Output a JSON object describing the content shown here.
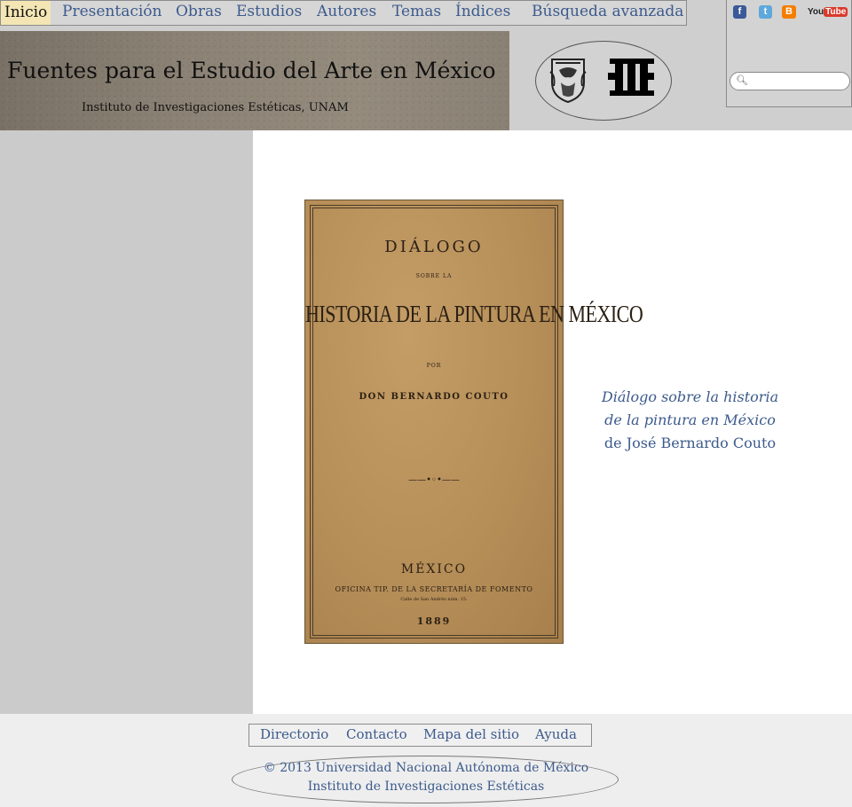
{
  "nav": {
    "items": [
      "Inicio",
      "Presentación",
      "Obras",
      "Estudios",
      "Autores",
      "Temas",
      "Índices",
      "Búsqueda avanzada"
    ],
    "active": "Inicio"
  },
  "banner": {
    "title": "Fuentes para el Estudio del Arte en México",
    "subtitle": "Instituto de Investigaciones Estéticas, UNAM"
  },
  "social": {
    "facebook": "f",
    "twitter": "t",
    "blogger": "B",
    "youtube_you": "You",
    "youtube_tube": "Tube"
  },
  "search": {
    "placeholder": ""
  },
  "book_cover": {
    "word1": "DIÁLOGO",
    "word2": "SOBRE LA",
    "title": "HISTORIA DE LA PINTURA EN MÉXICO",
    "por": "POR",
    "author": "DON BERNARDO COUTO",
    "ornament": "——•◦•——",
    "city": "MÉXICO",
    "office": "OFICINA TIP. DE LA SECRETARÍA DE FOMENTO",
    "street": "Calle de San Andrés núm. 15.",
    "year": "1889"
  },
  "caption": {
    "line1": "Diálogo sobre la historia",
    "line2": "de la pintura en México",
    "line3": "de José Bernardo Couto"
  },
  "footer": {
    "links": [
      "Directorio",
      "Contacto",
      "Mapa del sitio",
      "Ayuda"
    ],
    "copyright1": "© 2013 Universidad Nacional Autónoma de México",
    "copyright2": "Instituto de Investigaciones Estéticas"
  },
  "colors": {
    "link": "#3c5a8c",
    "active_tab_bg": "#f4e6b4",
    "header_bg": "#cfcfcf",
    "sidebar_bg": "#cbcbcb"
  }
}
